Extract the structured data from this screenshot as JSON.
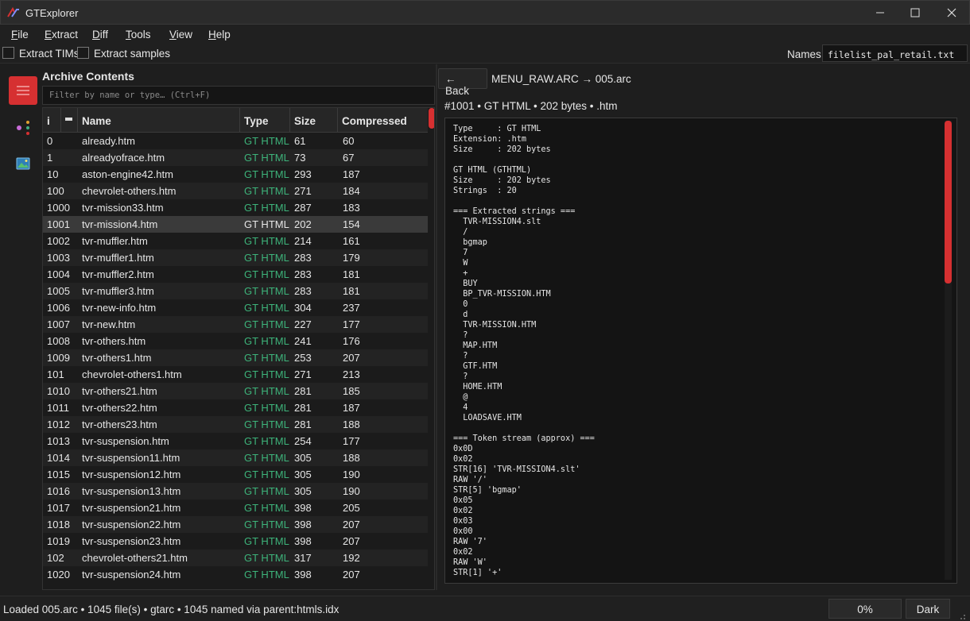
{
  "window": {
    "title": "GTExplorer"
  },
  "menu": [
    {
      "key": "F",
      "rest": "ile"
    },
    {
      "key": "E",
      "rest": "xtract"
    },
    {
      "key": "D",
      "rest": "iff"
    },
    {
      "key": "T",
      "rest": "ools"
    },
    {
      "key": "V",
      "rest": "iew"
    },
    {
      "key": "H",
      "rest": "elp"
    }
  ],
  "options": {
    "extract_tims": "Extract TIMs",
    "extract_samples": "Extract samples",
    "names_label": "Names:",
    "names_value": "filelist_pal_retail.txt"
  },
  "rail": [
    "list-icon",
    "graph-icon",
    "image-icon"
  ],
  "archive": {
    "title": "Archive Contents",
    "filter_placeholder": "Filter by name or type…  (Ctrl+F)",
    "columns": {
      "index": "i",
      "flag": "",
      "name": "Name",
      "type": "Type",
      "size": "Size",
      "compressed": "Compressed"
    },
    "selected_index": 5,
    "rows": [
      [
        "0",
        "already.htm",
        "GT HTML",
        "61",
        "60"
      ],
      [
        "1",
        "alreadyofrace.htm",
        "GT HTML",
        "73",
        "67"
      ],
      [
        "10",
        "aston-engine42.htm",
        "GT HTML",
        "293",
        "187"
      ],
      [
        "100",
        "chevrolet-others.htm",
        "GT HTML",
        "271",
        "184"
      ],
      [
        "1000",
        "tvr-mission33.htm",
        "GT HTML",
        "287",
        "183"
      ],
      [
        "1001",
        "tvr-mission4.htm",
        "GT HTML",
        "202",
        "154"
      ],
      [
        "1002",
        "tvr-muffler.htm",
        "GT HTML",
        "214",
        "161"
      ],
      [
        "1003",
        "tvr-muffler1.htm",
        "GT HTML",
        "283",
        "179"
      ],
      [
        "1004",
        "tvr-muffler2.htm",
        "GT HTML",
        "283",
        "181"
      ],
      [
        "1005",
        "tvr-muffler3.htm",
        "GT HTML",
        "283",
        "181"
      ],
      [
        "1006",
        "tvr-new-info.htm",
        "GT HTML",
        "304",
        "237"
      ],
      [
        "1007",
        "tvr-new.htm",
        "GT HTML",
        "227",
        "177"
      ],
      [
        "1008",
        "tvr-others.htm",
        "GT HTML",
        "241",
        "176"
      ],
      [
        "1009",
        "tvr-others1.htm",
        "GT HTML",
        "253",
        "207"
      ],
      [
        "101",
        "chevrolet-others1.htm",
        "GT HTML",
        "271",
        "213"
      ],
      [
        "1010",
        "tvr-others21.htm",
        "GT HTML",
        "281",
        "185"
      ],
      [
        "1011",
        "tvr-others22.htm",
        "GT HTML",
        "281",
        "187"
      ],
      [
        "1012",
        "tvr-others23.htm",
        "GT HTML",
        "281",
        "188"
      ],
      [
        "1013",
        "tvr-suspension.htm",
        "GT HTML",
        "254",
        "177"
      ],
      [
        "1014",
        "tvr-suspension11.htm",
        "GT HTML",
        "305",
        "188"
      ],
      [
        "1015",
        "tvr-suspension12.htm",
        "GT HTML",
        "305",
        "190"
      ],
      [
        "1016",
        "tvr-suspension13.htm",
        "GT HTML",
        "305",
        "190"
      ],
      [
        "1017",
        "tvr-suspension21.htm",
        "GT HTML",
        "398",
        "205"
      ],
      [
        "1018",
        "tvr-suspension22.htm",
        "GT HTML",
        "398",
        "207"
      ],
      [
        "1019",
        "tvr-suspension23.htm",
        "GT HTML",
        "398",
        "207"
      ],
      [
        "102",
        "chevrolet-others21.htm",
        "GT HTML",
        "317",
        "192"
      ],
      [
        "1020",
        "tvr-suspension24.htm",
        "GT HTML",
        "398",
        "207"
      ]
    ]
  },
  "detail": {
    "back_label": "← Back",
    "breadcrumb": "MENU_RAW.ARC  →  005.arc",
    "summary": "#1001  •  GT HTML  •  202 bytes  •  .htm",
    "text": "Type     : GT HTML\nExtension: .htm\nSize     : 202 bytes\n\nGT HTML (GTHTML)\nSize     : 202 bytes\nStrings  : 20\n\n=== Extracted strings ===\n  TVR-MISSION4.slt\n  /\n  bgmap\n  7\n  W\n  +\n  BUY\n  BP_TVR-MISSION.HTM\n  0\n  d\n  TVR-MISSION.HTM\n  ?\n  MAP.HTM\n  ?\n  GTF.HTM\n  ?\n  HOME.HTM\n  @\n  4\n  LOADSAVE.HTM\n\n=== Token stream (approx) ===\n0x0D\n0x02\nSTR[16] 'TVR-MISSION4.slt'\nRAW '/'\nSTR[5] 'bgmap'\n0x05\n0x02\n0x03\n0x00\nRAW '7'\n0x02\nRAW 'W'\nSTR[1] '+'"
  },
  "status": {
    "text": "Loaded 005.arc  •  1045 file(s)  •  gtarc  •  1045 named via parent:htmls.idx",
    "progress": "0%",
    "theme": "Dark"
  },
  "colors": {
    "accent": "#d63031",
    "type_green": "#3db37a",
    "background": "#1e1e1e"
  }
}
